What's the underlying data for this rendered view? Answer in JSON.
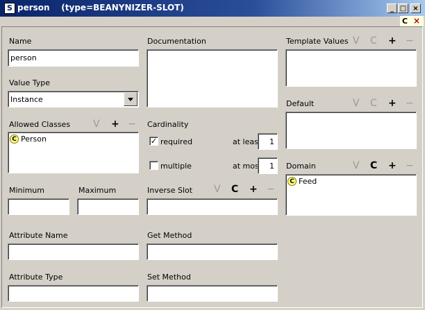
{
  "window": {
    "title": "person",
    "type_label": "(type=BEANYNIZER-SLOT)",
    "app_icon": "S",
    "min": "_",
    "max": "□",
    "close": "×"
  },
  "subtoolbar": {
    "c": "C",
    "x": "×"
  },
  "icons": {
    "v": "V",
    "c": "C",
    "plus": "+",
    "minus": "−",
    "class_badge": "C",
    "check": "✓"
  },
  "name": {
    "label": "Name",
    "value": "person"
  },
  "documentation": {
    "label": "Documentation",
    "value": ""
  },
  "template_values": {
    "label": "Template Values"
  },
  "value_type": {
    "label": "Value Type",
    "selected": "Instance"
  },
  "default": {
    "label": "Default"
  },
  "allowed_classes": {
    "label": "Allowed Classes",
    "items": [
      "Person"
    ]
  },
  "cardinality": {
    "label": "Cardinality",
    "required_label": "required",
    "required_checked": true,
    "multiple_label": "multiple",
    "multiple_checked": false,
    "at_least_label": "at least",
    "at_least_value": "1",
    "at_most_label": "at most",
    "at_most_value": "1"
  },
  "domain": {
    "label": "Domain",
    "items": [
      "Feed"
    ]
  },
  "minimum": {
    "label": "Minimum",
    "value": ""
  },
  "maximum": {
    "label": "Maximum",
    "value": ""
  },
  "inverse_slot": {
    "label": "Inverse Slot",
    "value": ""
  },
  "attribute_name": {
    "label": "Attribute Name",
    "value": ""
  },
  "get_method": {
    "label": "Get Method",
    "value": ""
  },
  "attribute_type": {
    "label": "Attribute Type",
    "value": ""
  },
  "set_method": {
    "label": "Set Method",
    "value": ""
  }
}
